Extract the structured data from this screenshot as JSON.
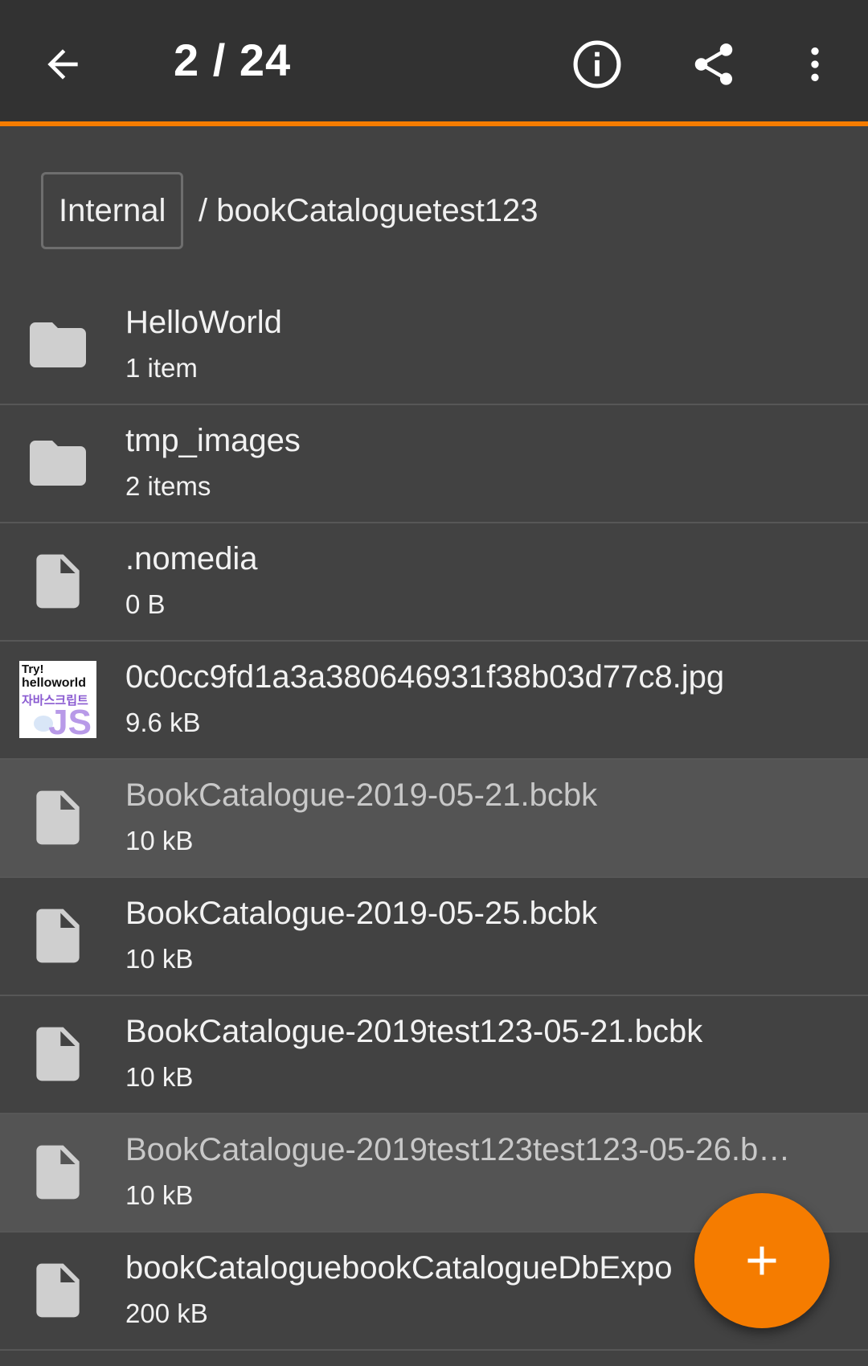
{
  "toolbar": {
    "title": "2 / 24",
    "back_icon": "arrow-back-icon",
    "info_icon": "info-icon",
    "share_icon": "share-icon",
    "more_icon": "more-vert-icon",
    "accent_color": "#f57c00"
  },
  "breadcrumb": {
    "root": "Internal",
    "path": "/ bookCataloguetest123"
  },
  "files": [
    {
      "name": "HelloWorld",
      "meta": "1 item",
      "icon": "folder-icon",
      "highlighted": false
    },
    {
      "name": "tmp_images",
      "meta": "2 items",
      "icon": "folder-icon",
      "highlighted": false
    },
    {
      "name": ".nomedia",
      "meta": "0 B",
      "icon": "file-icon",
      "highlighted": false
    },
    {
      "name": "0c0cc9fd1a3a380646931f38b03d77c8.jpg",
      "meta": "9.6 kB",
      "icon": "image-thumbnail",
      "highlighted": false,
      "thumb_text": [
        "Try!",
        "helloworld",
        "자바스크립트",
        "JS"
      ]
    },
    {
      "name": "BookCatalogue-2019-05-21.bcbk",
      "meta": "10 kB",
      "icon": "file-icon",
      "highlighted": true
    },
    {
      "name": "BookCatalogue-2019-05-25.bcbk",
      "meta": "10 kB",
      "icon": "file-icon",
      "highlighted": false
    },
    {
      "name": "BookCatalogue-2019test123-05-21.bcbk",
      "meta": "10 kB",
      "icon": "file-icon",
      "highlighted": false
    },
    {
      "name": "BookCatalogue-2019test123test123-05-26.b…",
      "meta": "10 kB",
      "icon": "file-icon",
      "highlighted": true
    },
    {
      "name": "bookCataloguebookCatalogueDbExpo",
      "meta": "200 kB",
      "icon": "file-icon",
      "highlighted": false
    }
  ],
  "fab": {
    "icon": "add-icon"
  }
}
